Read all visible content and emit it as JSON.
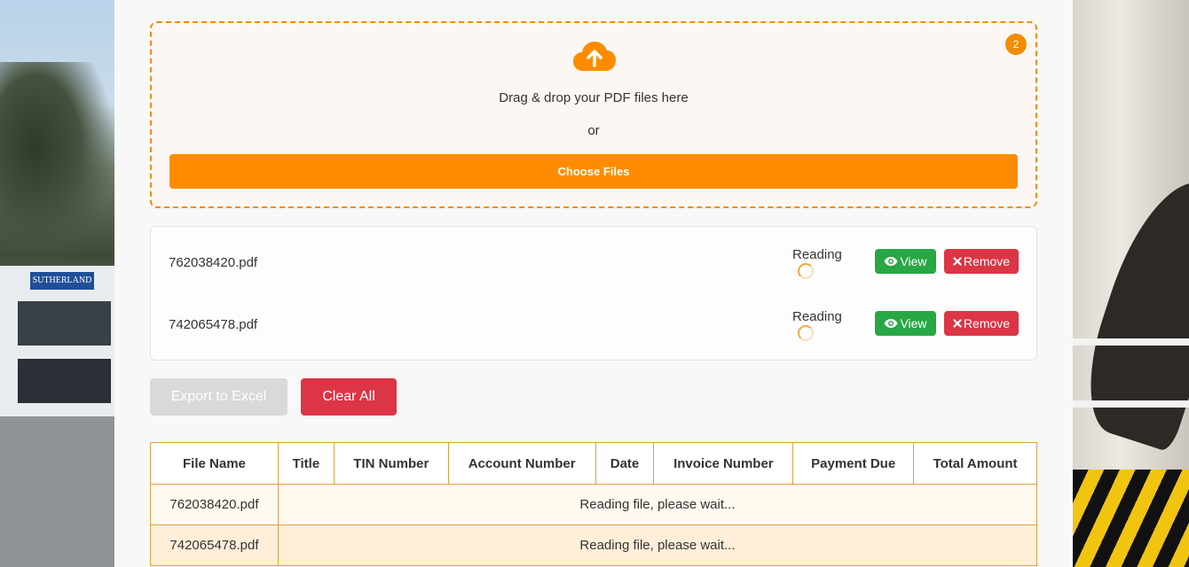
{
  "upload": {
    "badge_count": "2",
    "drag_text": "Drag & drop your PDF files here",
    "or_text": "or",
    "choose_label": "Choose Files"
  },
  "files": [
    {
      "name": "762038420.pdf",
      "status": "Reading",
      "view_label": "View",
      "remove_label": "Remove"
    },
    {
      "name": "742065478.pdf",
      "status": "Reading",
      "view_label": "View",
      "remove_label": "Remove"
    }
  ],
  "actions": {
    "export_label": "Export to Excel",
    "clear_label": "Clear All"
  },
  "table": {
    "headers": [
      "File Name",
      "Title",
      "TIN Number",
      "Account Number",
      "Date",
      "Invoice Number",
      "Payment Due",
      "Total Amount"
    ],
    "rows": [
      {
        "file": "762038420.pdf",
        "message": "Reading file, please wait..."
      },
      {
        "file": "742065478.pdf",
        "message": "Reading file, please wait..."
      }
    ]
  },
  "colors": {
    "accent": "#ff8c00",
    "success": "#28a745",
    "danger": "#dc3545",
    "disabled": "#d9d9d9"
  },
  "background": {
    "sign_text": "SUTHERLAND"
  }
}
